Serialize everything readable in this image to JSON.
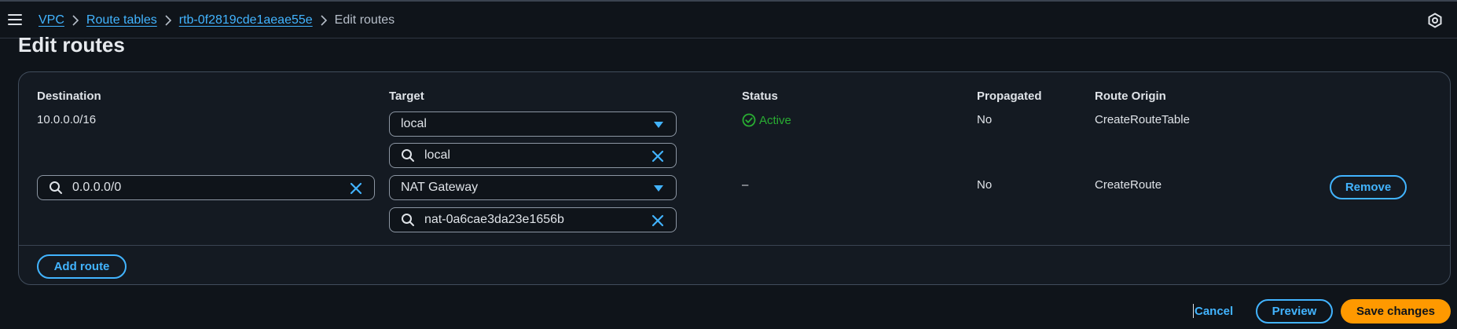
{
  "breadcrumb": {
    "items": [
      "VPC",
      "Route tables",
      "rtb-0f2819cde1aeae55e"
    ],
    "current": "Edit routes"
  },
  "page": {
    "title": "Edit routes"
  },
  "table": {
    "columns": [
      "Destination",
      "Target",
      "Status",
      "Propagated",
      "Route Origin"
    ],
    "rows": [
      {
        "destination": "10.0.0.0/16",
        "target_type": "local",
        "target_search": "local",
        "status": "Active",
        "propagated": "No",
        "origin": "CreateRouteTable"
      },
      {
        "destination": "0.0.0.0/0",
        "target_type": "NAT Gateway",
        "target_search": "nat-0a6cae3da23e1656b",
        "status": "–",
        "propagated": "No",
        "origin": "CreateRoute",
        "remove_label": "Remove"
      }
    ]
  },
  "actions": {
    "add_route": "Add route",
    "cancel": "Cancel",
    "preview": "Preview",
    "save": "Save changes"
  },
  "colors": {
    "link": "#42b4ff",
    "primary": "#ff9900",
    "success": "#29ad32",
    "background": "#0f141a"
  },
  "icons": [
    "menu-icon",
    "chevron-right-icon",
    "settings-hex-icon",
    "search-icon",
    "clear-icon",
    "caret-down-icon",
    "status-check-icon"
  ]
}
